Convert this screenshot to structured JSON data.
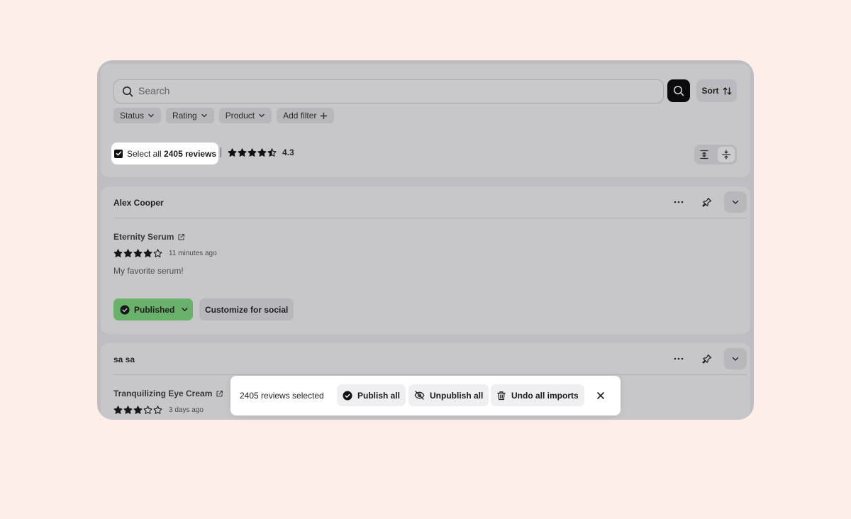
{
  "search": {
    "placeholder": "Search"
  },
  "toolbar": {
    "sort_label": "Sort",
    "filters": [
      "Status",
      "Rating",
      "Product",
      "Add filter"
    ]
  },
  "selection": {
    "select_all_prefix": "Select all",
    "select_all_count": "2405 reviews",
    "average_rating": "4.3",
    "average_stars": 4.3
  },
  "reviews": [
    {
      "author": "Alex Cooper",
      "product": "Eternity Serum",
      "stars": 4,
      "time": "11 minutes ago",
      "body": "My favorite serum!",
      "status_label": "Published",
      "secondary_action": "Customize for social"
    },
    {
      "author": "sa sa",
      "product": "Tranquilizing Eye Cream",
      "stars": 3,
      "time": "3 days ago"
    }
  ],
  "bulk_bar": {
    "selected_text": "2405 reviews selected",
    "publish_all": "Publish all",
    "unpublish_all": "Unpublish all",
    "undo_all_imports": "Undo all imports"
  },
  "colors": {
    "page_bg": "#fdeeea",
    "published_green": "#7dda7e",
    "search_button": "#000000"
  }
}
